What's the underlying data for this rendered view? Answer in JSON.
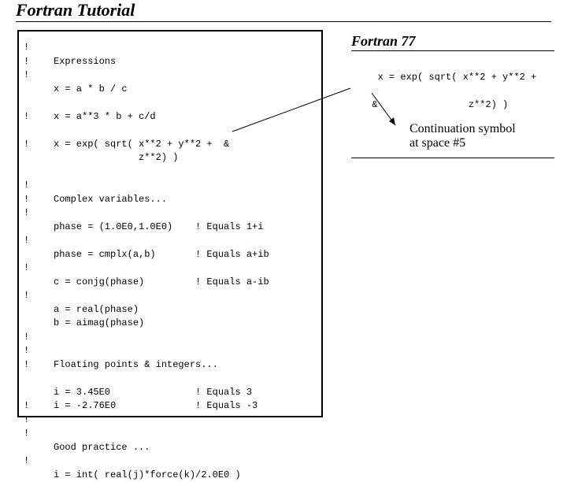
{
  "title": "Fortran Tutorial",
  "code": {
    "bangs": "!\n!\n!\n\n\n!\n\n!\n\n\n!\n!\n!\n\n!\n\n!\n\n!\n\n\n!\n!\n!\n\n\n!\n!\n!\n\n!",
    "body": "\nExpressions\n\nx = a * b / c\n\nx = a**3 * b + c/d\n\nx = exp( sqrt( x**2 + y**2 +  &\n               z**2) )\n\n\nComplex variables...\n\nphase = (1.0E0,1.0E0)    ! Equals 1+i\n\nphase = cmplx(a,b)       ! Equals a+ib\n\nc = conjg(phase)         ! Equals a-ib\n\na = real(phase)\nb = aimag(phase)\n\n\nFloating points & integers...\n\ni = 3.45E0               ! Equals 3\ni = -2.76E0              ! Equals -3\n\n\nGood practice ...\n\ni = int( real(j)*force(k)/2.0E0 )"
  },
  "f77": {
    "title": "Fortran 77",
    "code": "   x = exp( sqrt( x**2 + y**2 +\n\n  &                z**2) )"
  },
  "callout": {
    "line1": "Continuation symbol",
    "line2": "at space #5"
  }
}
